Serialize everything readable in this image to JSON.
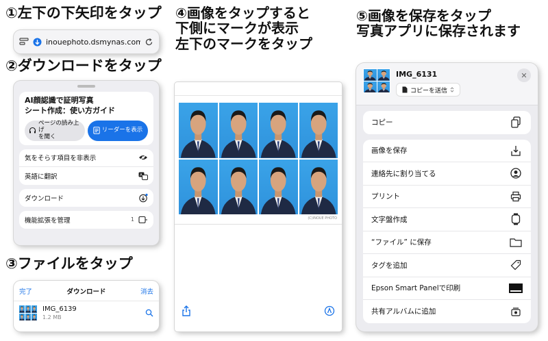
{
  "steps": {
    "s1": [
      "①左下の下矢印をタップ"
    ],
    "s2": [
      "②ダウンロードをタップ"
    ],
    "s3": [
      "③ファイルをタップ"
    ],
    "s4": [
      "④画像をタップすると",
      "下側にマークが表示",
      "左下のマークをタップ"
    ],
    "s5": [
      "⑤画像を保存をタップ",
      "写真アプリに保存されます"
    ]
  },
  "url_bar": {
    "url": "inouephoto.dsmynas.com",
    "icons": [
      "reader-menu-icon",
      "download-badge-icon",
      "reload-icon"
    ]
  },
  "reader_menu": {
    "title_line1": "AI顔認識で証明写真",
    "title_line2": "シート作成：使い方ガイド",
    "listen_label_line1": "ページの読み上げ",
    "listen_label_line2": "を聞く",
    "reader_label": "リーダーを表示",
    "group1": [
      {
        "label": "気をそらす項目を非表示",
        "icon": "eye-slash-icon"
      },
      {
        "label": "英語に翻訳",
        "icon": "translate-icon"
      }
    ],
    "group2": [
      {
        "label": "ダウンロード",
        "icon": "download-circle-icon"
      }
    ],
    "group3": [
      {
        "label": "機能拡張を管理",
        "count": "1",
        "icon": "extensions-icon"
      }
    ]
  },
  "downloads": {
    "done": "完了",
    "title": "ダウンロード",
    "clear": "消去",
    "file_name": "IMG_6139",
    "file_size": "1.2 MB"
  },
  "viewer": {
    "watermark": "(C)INOUE PHOTO",
    "photo_count": 8
  },
  "share_sheet": {
    "file_name": "IMG_6131",
    "send_label": "コピーを送信",
    "copy_group": [
      {
        "label": "コピー",
        "icon": "copy-icon"
      }
    ],
    "actions": [
      {
        "label": "画像を保存",
        "icon": "save-image-icon"
      },
      {
        "label": "連絡先に割り当てる",
        "icon": "contact-icon"
      },
      {
        "label": "プリント",
        "icon": "printer-icon"
      },
      {
        "label": "文字盤作成",
        "icon": "watch-icon"
      },
      {
        "label": "“ファイル” に保存",
        "icon": "folder-icon"
      },
      {
        "label": "タグを追加",
        "icon": "tag-icon"
      },
      {
        "label": "Epson Smart Panelで印刷",
        "icon": "epson-icon"
      },
      {
        "label": "共有アルバムに追加",
        "icon": "shared-album-icon"
      }
    ]
  },
  "colors": {
    "ios_blue": "#1a73e8",
    "photo_background": "#3aa3e8",
    "suit": "#1f2a44"
  }
}
